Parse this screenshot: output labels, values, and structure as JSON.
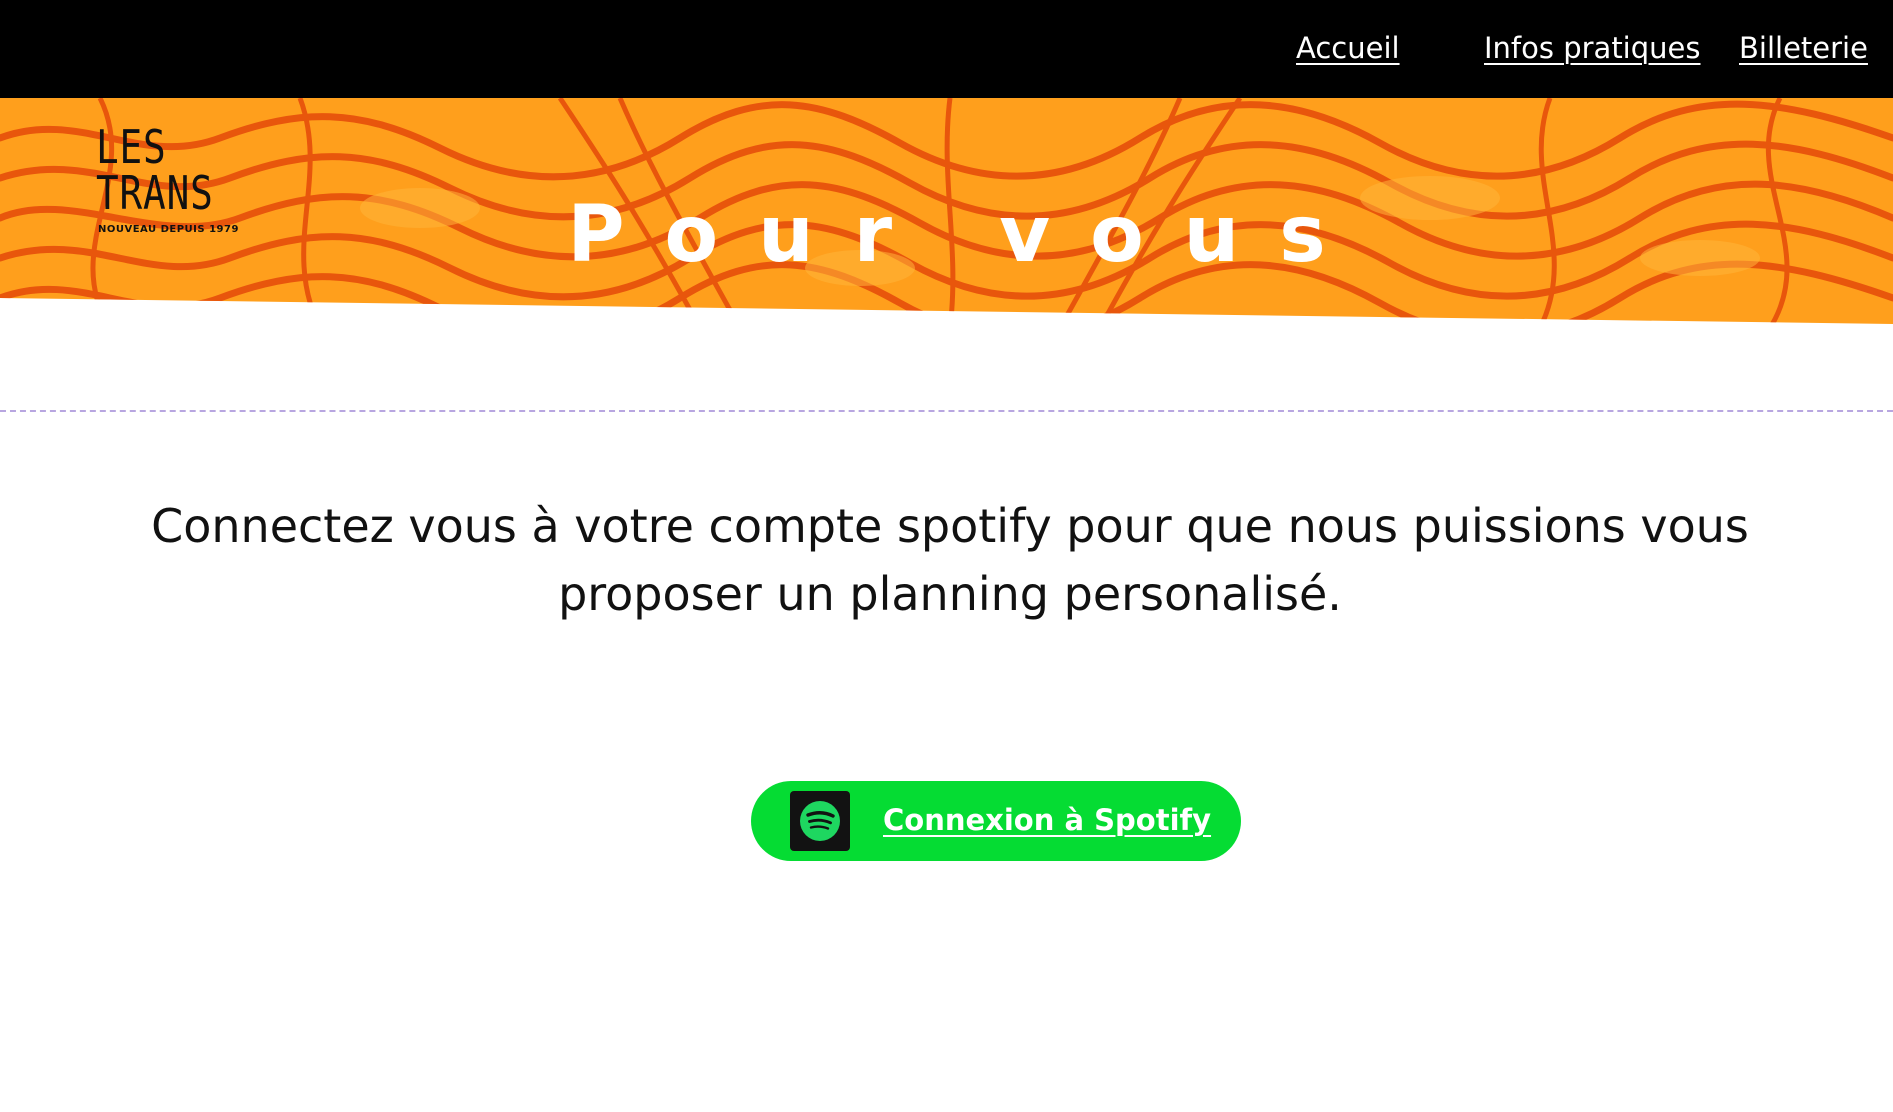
{
  "nav": {
    "accueil": "Accueil",
    "infos": "Infos pratiques",
    "billetterie": "Billeterie"
  },
  "hero": {
    "title": "Pour vous",
    "logo_line1": "LES",
    "logo_line2": "TRANS",
    "logo_tagline": "NOUVEAU DEPUIS 1979"
  },
  "main": {
    "intro": "Connectez vous à votre compte spotify pour que nous puissions vous proposer un planning personalisé.",
    "spotify_button_label": "Connexion à Spotify"
  },
  "colors": {
    "nav_bg": "#000000",
    "hero_orange": "#ff9a1a",
    "hero_dark_orange": "#e85a0c",
    "divider": "#b8a6e0",
    "spotify_green": "#05dc33",
    "spotify_icon_green": "#1ed760"
  },
  "icons": {
    "spotify": "spotify-icon"
  }
}
